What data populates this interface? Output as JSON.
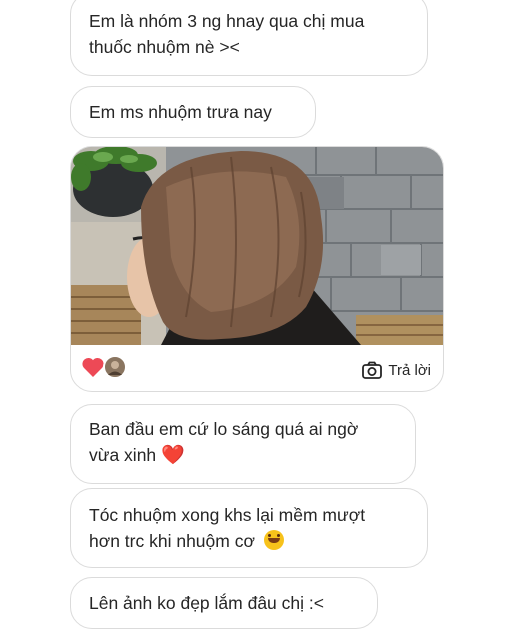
{
  "messages": [
    {
      "line1": "Em là nhóm 3 ng hnay qua chị mua",
      "line2": "thuốc nhuộm nè ><"
    },
    {
      "text": "Em ms nhuộm trưa nay"
    },
    {
      "line1": "Ban đầu em cứ lo sáng quá ai ngờ",
      "line2": "vừa xinh",
      "emoji": "❤️"
    },
    {
      "line1": "Tóc nhuộm xong khs lại mềm mượt",
      "line2": "hơn trc khi nhuộm cơ",
      "emoji": "rolling-on-floor-laughing"
    },
    {
      "text": "Lên ảnh ko đẹp lắm đâu chị :<"
    }
  ],
  "photo_card": {
    "reply_label": "Trả lời",
    "reaction_icon": "heart-icon",
    "colors": {
      "heart": "#ed4956"
    }
  }
}
